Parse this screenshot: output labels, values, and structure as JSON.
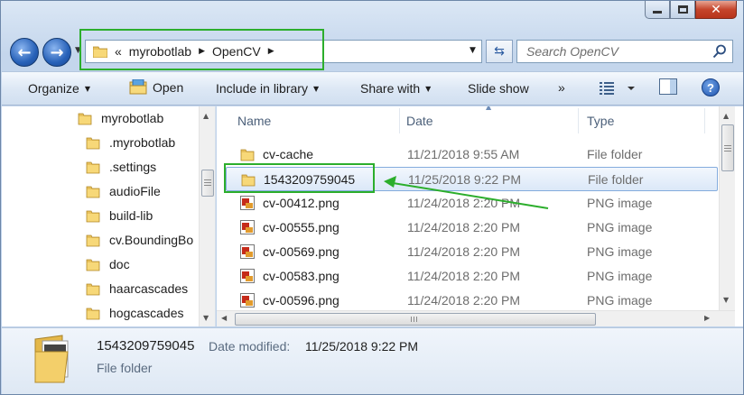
{
  "window": {
    "caption": {
      "minimize": "minimize",
      "maximize": "maximize",
      "close": "✕"
    }
  },
  "address": {
    "overflow": "«",
    "path": [
      "myrobotlab",
      "OpenCV"
    ],
    "separator": "▶"
  },
  "search": {
    "placeholder": "Search OpenCV"
  },
  "toolbar": {
    "organize": "Organize",
    "open": "Open",
    "include_in_library": "Include in library",
    "share_with": "Share with",
    "slide_show": "Slide show",
    "more": "»"
  },
  "navpane": {
    "items": [
      "myrobotlab",
      ".myrobotlab",
      ".settings",
      "audioFile",
      "build-lib",
      "cv.BoundingBo",
      "doc",
      "haarcascades",
      "hogcascades"
    ]
  },
  "filelist": {
    "columns": {
      "name": "Name",
      "date": "Date",
      "type": "Type"
    },
    "rows": [
      {
        "name": "cv-cache",
        "date": "11/21/2018 9:55 AM",
        "type": "File folder",
        "icon": "folder-icon"
      },
      {
        "name": "1543209759045",
        "date": "11/25/2018 9:22 PM",
        "type": "File folder",
        "icon": "folder-icon"
      },
      {
        "name": "cv-00412.png",
        "date": "11/24/2018 2:20 PM",
        "type": "PNG image",
        "icon": "png-file-icon"
      },
      {
        "name": "cv-00555.png",
        "date": "11/24/2018 2:20 PM",
        "type": "PNG image",
        "icon": "png-file-icon"
      },
      {
        "name": "cv-00569.png",
        "date": "11/24/2018 2:20 PM",
        "type": "PNG image",
        "icon": "png-file-icon"
      },
      {
        "name": "cv-00583.png",
        "date": "11/24/2018 2:20 PM",
        "type": "PNG image",
        "icon": "png-file-icon"
      },
      {
        "name": "cv-00596.png",
        "date": "11/24/2018 2:20 PM",
        "type": "PNG image",
        "icon": "png-file-icon"
      }
    ]
  },
  "details": {
    "name": "1543209759045",
    "modified_label": "Date modified:",
    "modified_value": "11/25/2018 9:22 PM",
    "type": "File folder"
  },
  "colors": {
    "highlight": "#2cae2c",
    "selection_border": "#84acdd"
  }
}
